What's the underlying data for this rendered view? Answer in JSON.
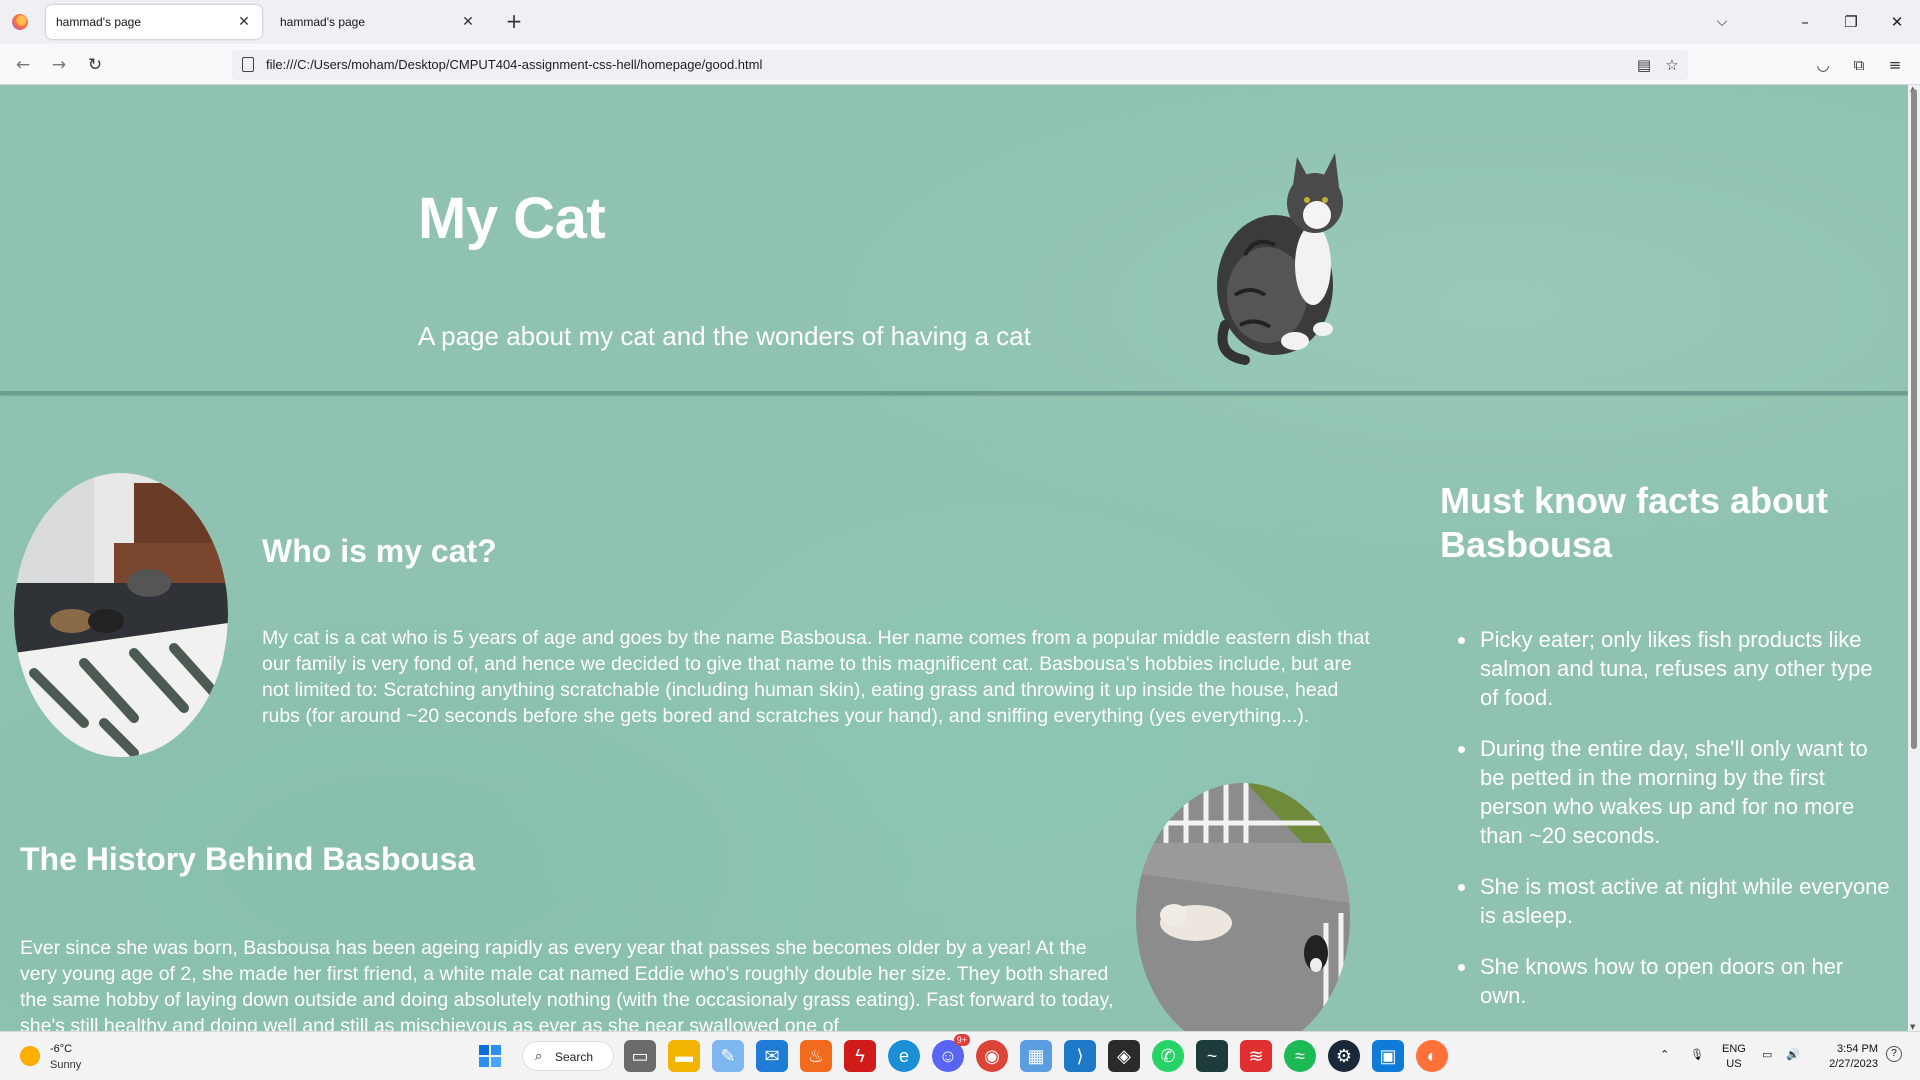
{
  "browser": {
    "tabs": [
      {
        "title": "hammad's page",
        "active": true
      },
      {
        "title": "hammad's page",
        "active": false
      }
    ],
    "url": "file:///C:/Users/moham/Desktop/CMPUT404-assignment-css-hell/homepage/good.html"
  },
  "page": {
    "hero": {
      "title": "My Cat",
      "subtitle": "A page about my cat and the wonders of having a cat"
    },
    "who": {
      "title": "Who is my cat?",
      "text": "My cat is a cat who is 5 years of age and goes by the name Basbousa. Her name comes from a popular middle eastern dish that our family is very fond of, and hence we decided to give that name to this magnificent cat. Basbousa's hobbies include, but are not limited to: Scratching anything scratchable (including human skin), eating grass and throwing it up inside the house, head rubs (for around ~20 seconds before she gets bored and scratches your hand), and sniffing everything (yes everything...)."
    },
    "history": {
      "title": "The History Behind Basbousa",
      "text": "Ever since she was born, Basbousa has been ageing rapidly as every year that passes she becomes older by a year! At the very young age of 2, she made her first friend, a white male cat named Eddie who's roughly double her size. They both shared the same hobby of laying down outside and doing absolutely nothing (with the occasionaly grass eating). Fast forward to today, she's still healthy and doing well and still as mischievous as ever as she near swallowed one of"
    },
    "facts": {
      "title": "Must know facts about Basbousa",
      "items": [
        "Picky eater; only likes fish products like salmon and tuna, refuses any other type of food.",
        "During the entire day, she'll only want to be petted in the morning by the first person who wakes up and for no more than ~20 seconds.",
        "She is most active at night while everyone is asleep.",
        "She knows how to open doors on her own."
      ]
    }
  },
  "taskbar": {
    "weather_temp": "-6°C",
    "weather_cond": "Sunny",
    "search_label": "Search",
    "lang_top": "ENG",
    "lang_bottom": "US",
    "time": "3:54 PM",
    "date": "2/27/2023",
    "discord_badge": "9+"
  }
}
